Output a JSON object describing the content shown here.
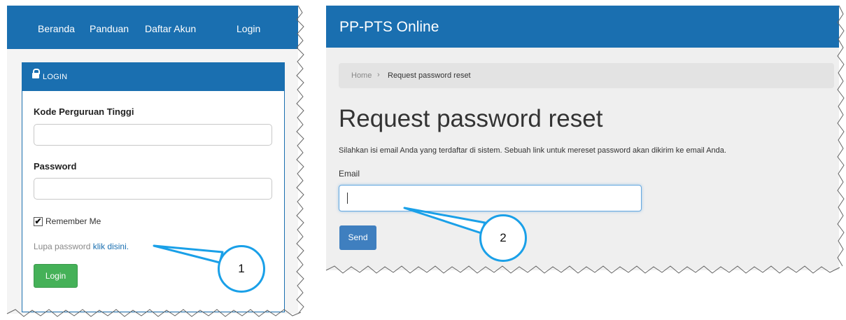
{
  "left": {
    "nav": [
      "Beranda",
      "Panduan",
      "Daftar Akun",
      "Login"
    ],
    "panel_title": "LOGIN",
    "kode_label": "Kode Perguruan Tinggi",
    "password_label": "Password",
    "remember_label": "Remember Me",
    "remember_checked": true,
    "forgot_text": "Lupa password",
    "forgot_link": "klik disini.",
    "login_button": "Login"
  },
  "right": {
    "brand": "PP-PTS Online",
    "breadcrumb": {
      "home": "Home",
      "separator": "›",
      "current": "Request password reset"
    },
    "heading": "Request password reset",
    "description": "Silahkan isi email Anda yang terdaftar di sistem. Sebuah link untuk mereset password akan dikirim ke email Anda.",
    "email_label": "Email",
    "email_value": "",
    "send_button": "Send"
  },
  "annotations": {
    "callout1": "1",
    "callout2": "2"
  },
  "colors": {
    "primary_blue": "#1a6fb0",
    "button_green": "#45b158",
    "button_blue": "#3f7fbf",
    "callout_blue": "#1aa0e8",
    "link_blue": "#1a6fb0"
  },
  "icons": [
    "lock-icon",
    "check-icon",
    "breadcrumb-chevron-icon"
  ]
}
